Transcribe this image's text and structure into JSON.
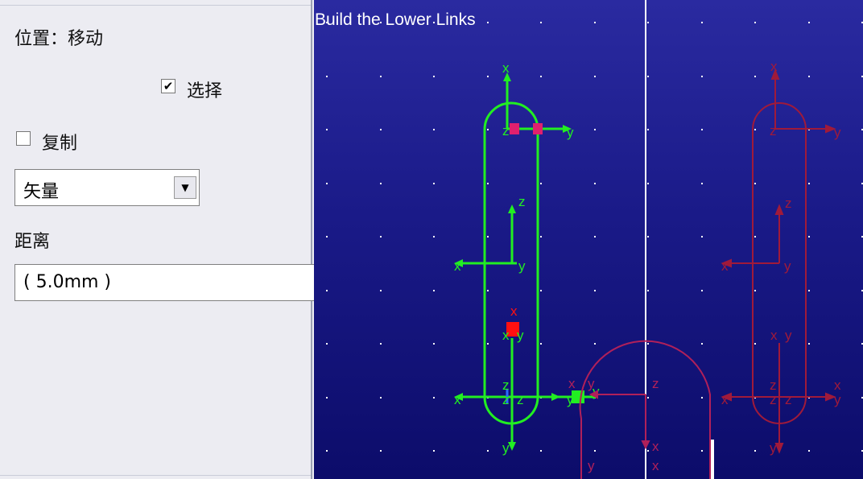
{
  "panel": {
    "position_label": "位置：移动",
    "select_label": "选择",
    "select_checked": true,
    "copy_label": "复制",
    "copy_checked": false,
    "mode_value": "矢量",
    "distance_label": "距离",
    "distance_value": "( 5.0mm )"
  },
  "viewport": {
    "title": "Build the Lower Links",
    "axis_labels": {
      "x": "x",
      "y": "y",
      "z": "z"
    },
    "colors": {
      "background_top": "#2a2aa0",
      "background_bottom": "#0c0c6a",
      "active_link": "#22ee22",
      "ghost_link": "#a01a3a",
      "arc_curve": "#b0205a",
      "handle_red": "#ff1010",
      "handle_magenta": "#e0206e",
      "grid_dot": "#ffffff"
    }
  }
}
